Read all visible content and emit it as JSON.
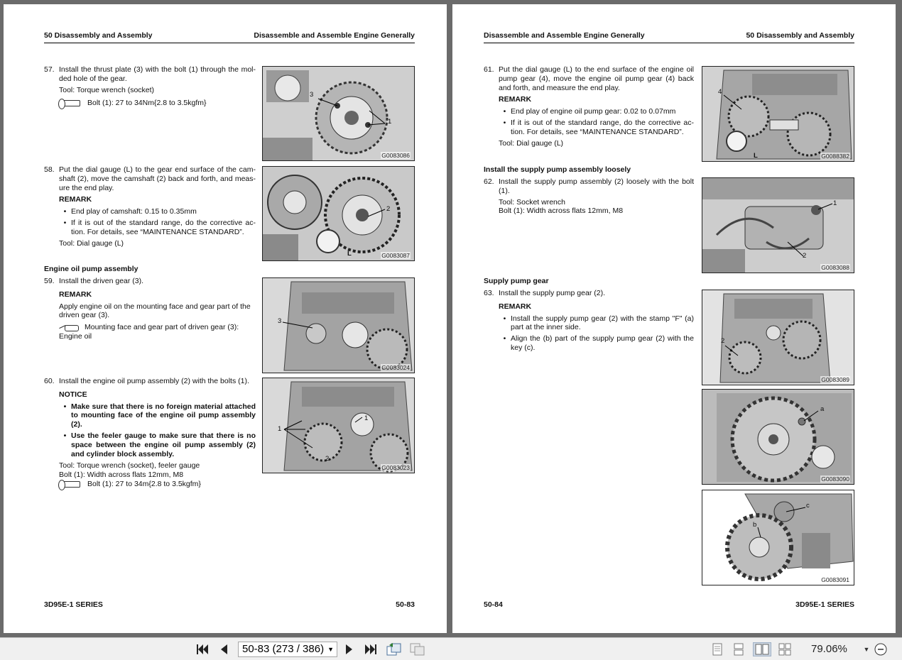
{
  "left_page": {
    "header_left": "50 Disassembly and Assembly",
    "header_right": "Disassemble and Assemble Engine Generally",
    "footer_left": "3D95E-1 SERIES",
    "footer_right": "50-83",
    "step57": {
      "num": "57.",
      "text": "Install the thrust plate (3) with the bolt (1) through the mol-ded hole of the gear.",
      "tool": "Tool: Torque wrench (socket)",
      "torque": "Bolt (1): 27 to 34Nm{2.8 to 3.5kgfm}"
    },
    "step58": {
      "num": "58.",
      "text": "Put the dial gauge (L) to the gear end surface of the cam-shaft (2), move the camshaft (2) back and forth, and meas-ure the end play.",
      "remark": "REMARK",
      "bullet1": "End play of camshaft: 0.15 to 0.35mm",
      "bullet2": "If it is out of the standard range, do the corrective ac-tion. For details, see “MAINTENANCE STANDARD”.",
      "tool": "Tool: Dial gauge (L)"
    },
    "section_oil_pump": "Engine oil pump assembly",
    "step59": {
      "num": "59.",
      "text": "Install the driven gear (3).",
      "remark": "REMARK",
      "para": "Apply engine oil on the mounting face and gear part of the driven gear (3).",
      "oil": "Mounting face and gear part of driven gear (3): Engine oil"
    },
    "step60": {
      "num": "60.",
      "text": "Install the engine oil pump assembly (2) with the bolts (1).",
      "notice": "NOTICE",
      "bullet1": "Make sure that there is no foreign material attached to mounting face of the engine oil pump assembly (2).",
      "bullet2": "Use the feeler gauge to make sure that there is no space between the engine oil pump assembly (2) and cylinder block assembly.",
      "tool": "Tool: Torque wrench (socket), feeler gauge",
      "bolt": "Bolt (1): Width across flats 12mm, M8",
      "torque": "Bolt (1): 27 to 34m{2.8 to 3.5kgfm}"
    },
    "figures": {
      "f1": {
        "id": "G0083086",
        "c1": "3",
        "c2": "1"
      },
      "f2": {
        "id": "G0083087",
        "c1": "2",
        "c2": "L"
      },
      "f3": {
        "id": "G0083024",
        "c1": "3"
      },
      "f4": {
        "id": "G0083023",
        "c1": "1",
        "c2": "1",
        "c3": "2"
      }
    }
  },
  "right_page": {
    "header_left": "Disassemble and Assemble Engine Generally",
    "header_right": "50 Disassembly and Assembly",
    "footer_left": "50-84",
    "footer_right": "3D95E-1 SERIES",
    "step61": {
      "num": "61.",
      "text": "Put the dial gauge (L) to the end surface of the engine oil pump gear (4), move the engine oil pump gear (4) back and forth, and measure the end play.",
      "remark": "REMARK",
      "bullet1": "End play of engine oil pump gear: 0.02 to 0.07mm",
      "bullet2": "If it is out of the standard range, do the corrective ac-tion. For details, see “MAINTENANCE STANDARD”.",
      "tool": "Tool: Dial gauge (L)"
    },
    "section_supply_loose": "Install the supply pump assembly loosely",
    "step62": {
      "num": "62.",
      "text": "Install the supply pump assembly (2) loosely with the bolt (1).",
      "tool": "Tool: Socket wrench",
      "bolt": "Bolt (1): Width across flats 12mm, M8"
    },
    "section_supply_gear": "Supply pump gear",
    "step63": {
      "num": "63.",
      "text": "Install the supply pump gear (2).",
      "remark": "REMARK",
      "bullet1": "Install the supply pump gear (2) with the stamp \"F\" (a) part at the inner side.",
      "bullet2": "Align the (b) part of the supply pump gear (2) with the key (c)."
    },
    "figures": {
      "f1": {
        "id": "G0088382",
        "c1": "4",
        "c2": "L"
      },
      "f2": {
        "id": "G0083088",
        "c1": "1",
        "c2": "2"
      },
      "f3": {
        "id": "G0083089",
        "c1": "2"
      },
      "f4": {
        "id": "G0083090",
        "c1": "a"
      },
      "f5": {
        "id": "G0083091",
        "c1": "c",
        "c2": "b"
      }
    }
  },
  "toolbar": {
    "page_value": "50-83 (273 / 386)",
    "zoom": "79.06%"
  }
}
